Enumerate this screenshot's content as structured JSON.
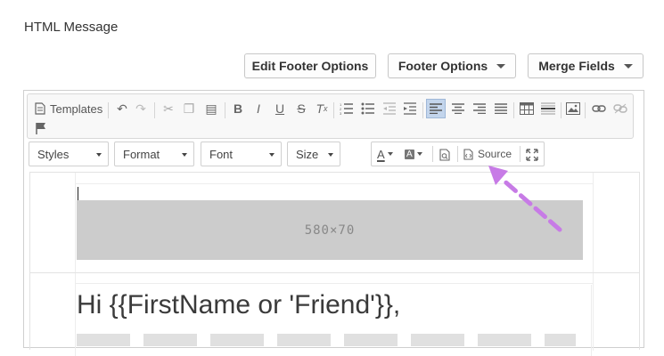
{
  "section_title": "HTML Message",
  "buttons": {
    "edit_footer": "Edit Footer Options",
    "footer_options": "Footer Options",
    "merge_fields": "Merge Fields"
  },
  "toolbar": {
    "templates_label": "Templates",
    "dropdowns": [
      "Styles",
      "Format",
      "Font",
      "Size"
    ],
    "source_label": "Source"
  },
  "content": {
    "banner_text": "580×70",
    "greeting": "Hi {{FirstName or 'Friend'}},"
  },
  "colors": {
    "active_button": "#c3d5ec",
    "arrow": "#c77be6",
    "banner": "#cccccc"
  }
}
